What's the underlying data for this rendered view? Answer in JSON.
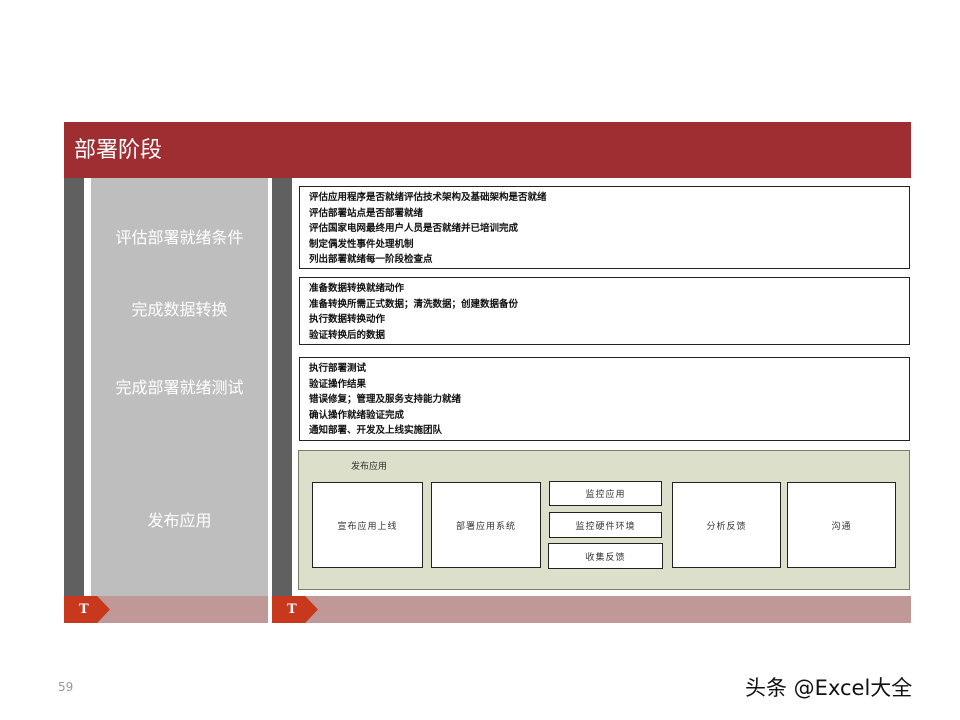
{
  "header": {
    "title": "部署阶段"
  },
  "stages": [
    {
      "label": "评估部署就绪条件"
    },
    {
      "label": "完成数据转换"
    },
    {
      "label": "完成部署就绪测试"
    },
    {
      "label": "发布应用"
    }
  ],
  "details": [
    {
      "lines": [
        "评估应用程序是否就绪评估技术架构及基础架构是否就绪",
        "评估部署站点是否部署就绪",
        "评估国家电网最终用户人员是否就绪并已培训完成",
        "制定偶发性事件处理机制",
        "列出部署就绪每一阶段检查点"
      ]
    },
    {
      "lines": [
        "准备数据转换就绪动作",
        "准备转换所需正式数据；清洗数据；创建数据备份",
        "执行数据转换动作",
        "验证转换后的数据"
      ]
    },
    {
      "lines": [
        "执行部署测试",
        "验证操作结果",
        "错误修复；管理及服务支持能力就绪",
        "确认操作就绪验证完成",
        "通知部署、开发及上线实施团队"
      ]
    }
  ],
  "release": {
    "title": "发布应用",
    "steps": [
      "宣布应用上线",
      "部署应用系统",
      "监控应用",
      "监控硬件环境",
      "收集反馈",
      "分析反馈",
      "沟通"
    ]
  },
  "footer": {
    "tag_left": "T",
    "tag_right": "T"
  },
  "page_number": "59",
  "watermark": "头条 @Excel大全"
}
